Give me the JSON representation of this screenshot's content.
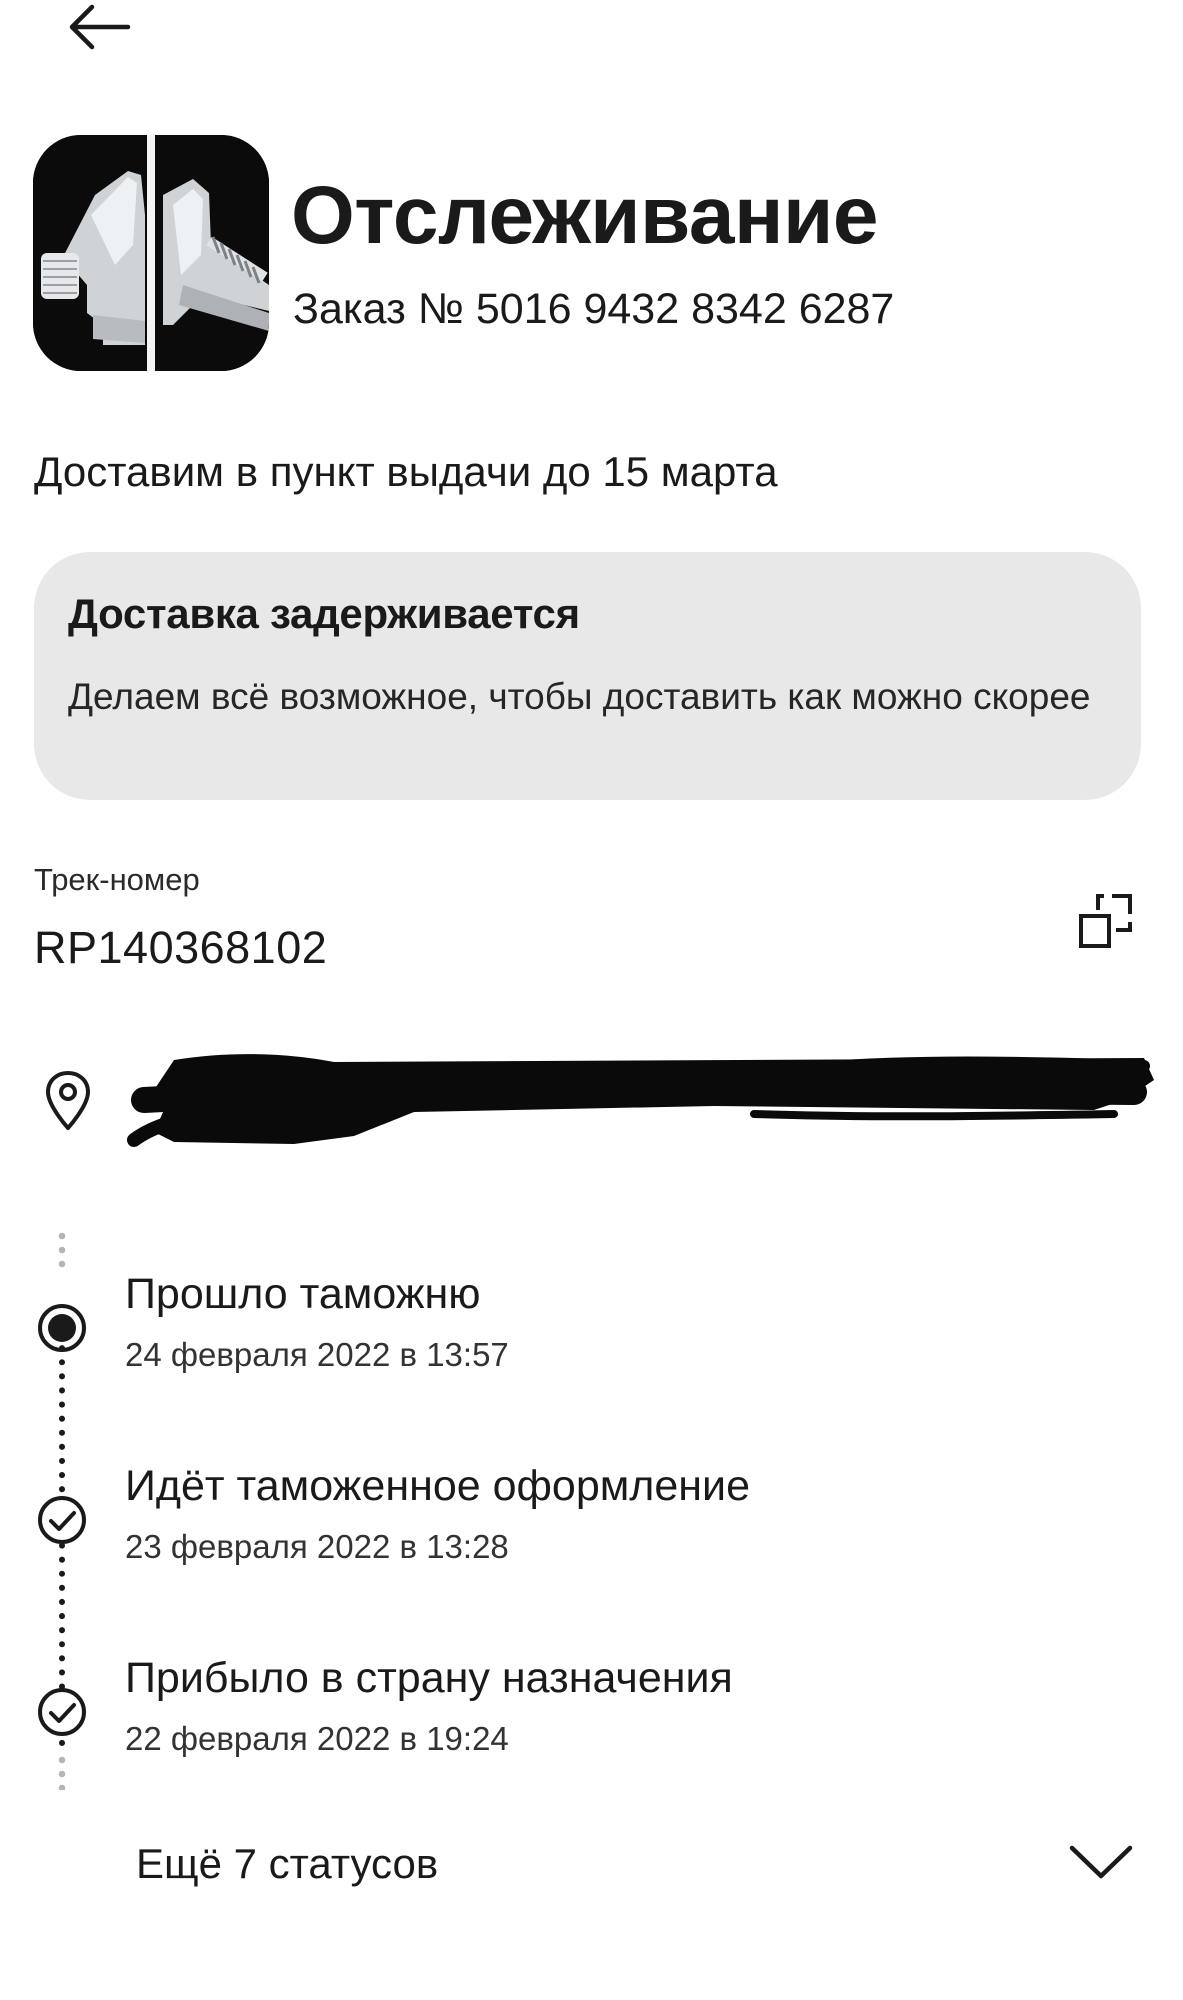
{
  "header": {
    "title": "Отслеживание",
    "order_label": "Заказ №",
    "order_number": "5016 9432 8342 6287"
  },
  "delivery": {
    "estimate": "Доставим в пункт выдачи до 15 марта"
  },
  "notice": {
    "title": "Доставка задерживается",
    "text": "Делаем всё возможное, чтобы доставить как можно скорее"
  },
  "tracking": {
    "label": "Трек-номер",
    "number": "RP140368102"
  },
  "timeline": [
    {
      "status": "Прошло таможню",
      "time": "24 февраля 2022 в 13:57",
      "state": "current"
    },
    {
      "status": "Идёт таможенное оформление",
      "time": "23 февраля 2022 в 13:28",
      "state": "done"
    },
    {
      "status": "Прибыло в страну назначения",
      "time": "22 февраля 2022 в 19:24",
      "state": "done"
    }
  ],
  "more": {
    "label": "Ещё 7 статусов"
  },
  "icons": {
    "back": "arrow-left-icon",
    "copy": "copy-icon",
    "location": "map-pin-icon",
    "current": "radio-filled-icon",
    "done": "check-circle-icon",
    "expand": "chevron-down-icon"
  },
  "colors": {
    "text": "#1a1a1a",
    "card_bg": "#e8e8e8",
    "background": "#ffffff"
  }
}
